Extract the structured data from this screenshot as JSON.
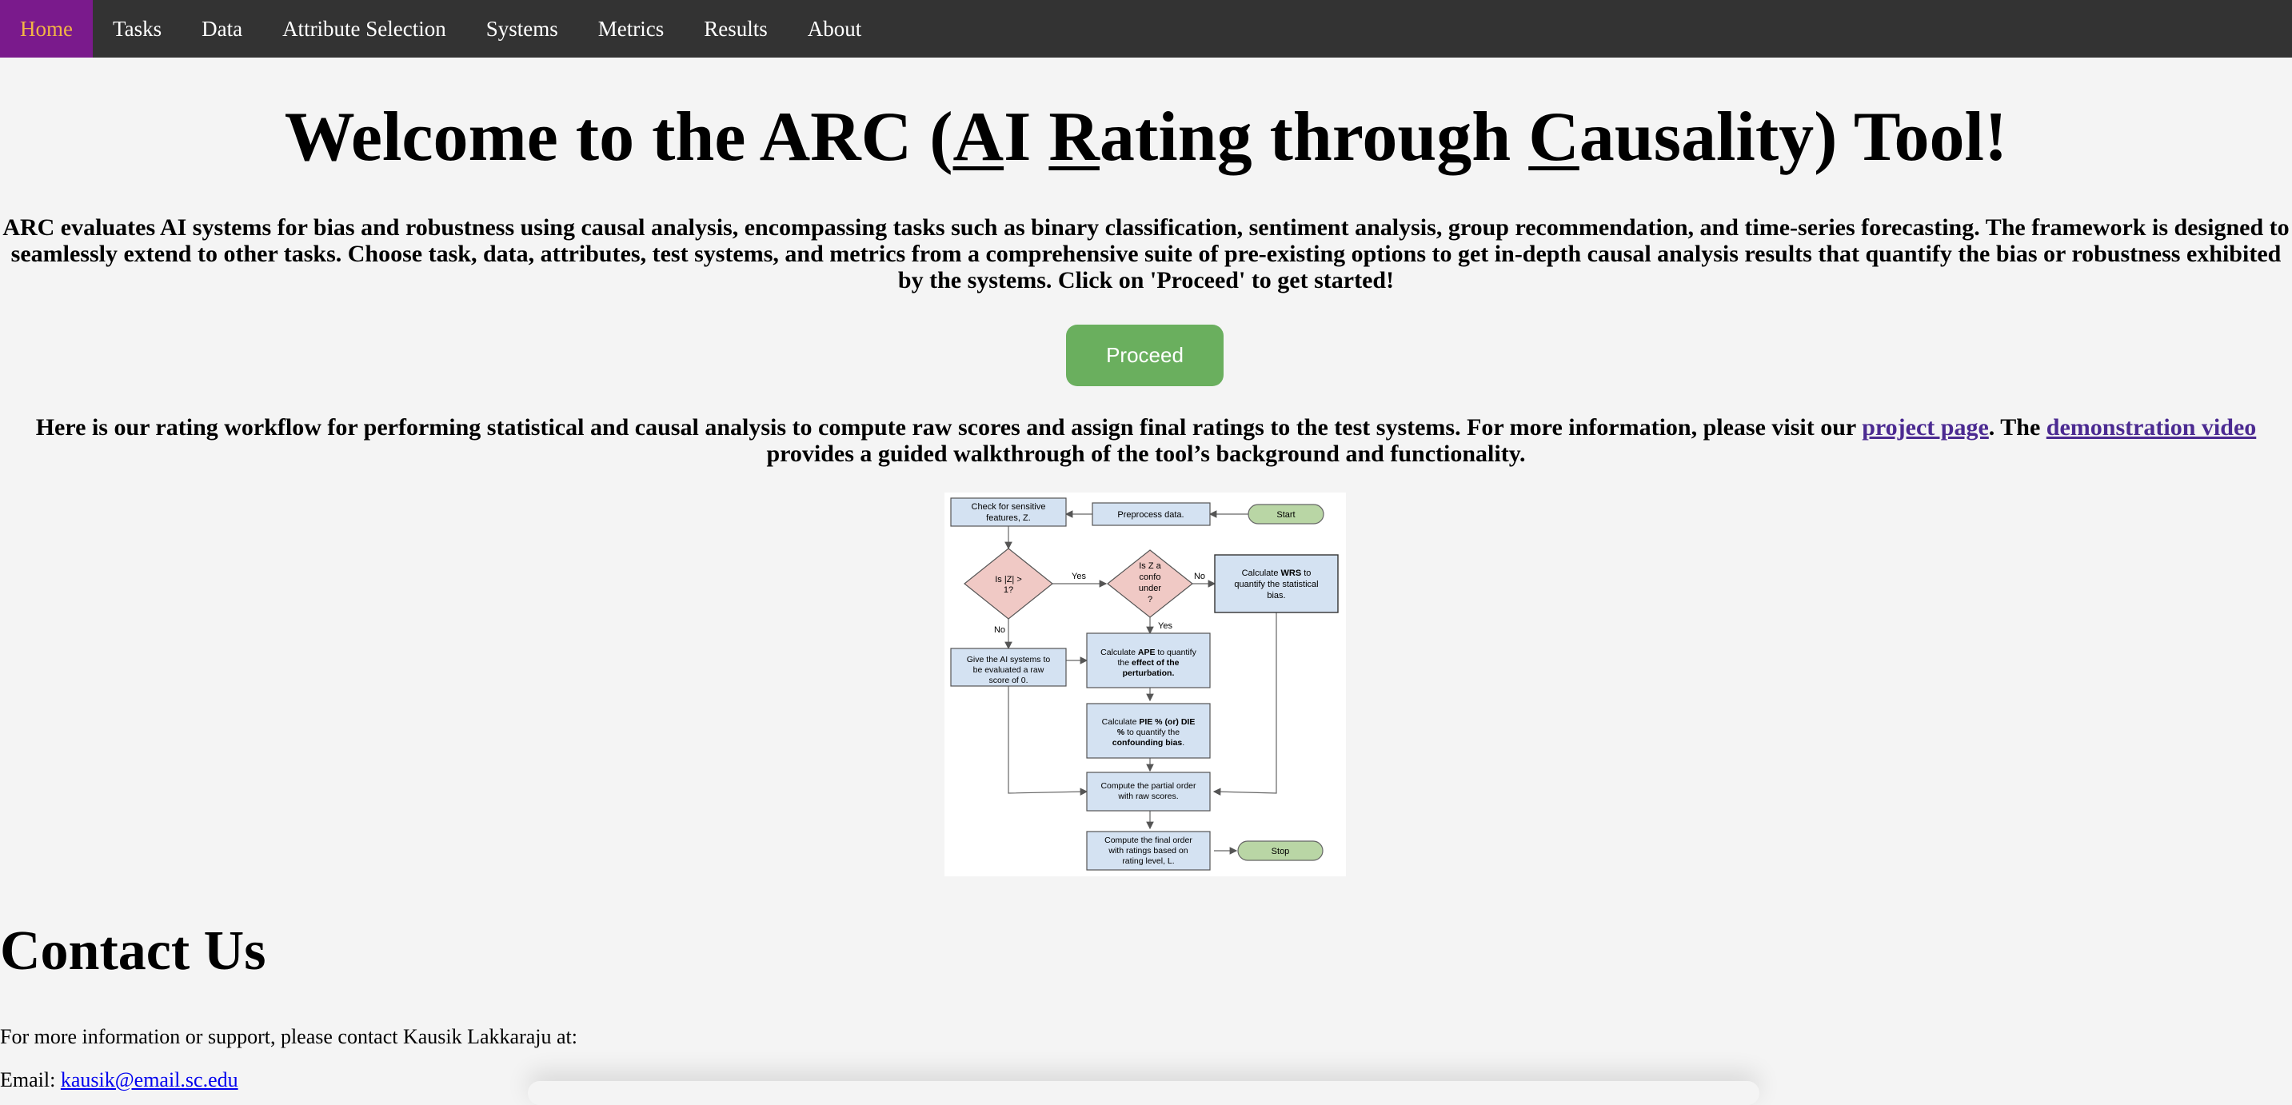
{
  "nav": {
    "items": [
      {
        "label": "Home"
      },
      {
        "label": "Tasks"
      },
      {
        "label": "Data"
      },
      {
        "label": "Attribute Selection"
      },
      {
        "label": "Systems"
      },
      {
        "label": "Metrics"
      },
      {
        "label": "Results"
      },
      {
        "label": "About"
      }
    ],
    "active_color": "#7a1a8c",
    "active_text_color": "#f2b544",
    "bar_color": "#333333"
  },
  "title": {
    "prefix": "Welcome to the ARC (",
    "a": "A",
    "i": "I ",
    "r": "R",
    "ating": "ating through ",
    "c": "C",
    "rest": "ausality) Tool!"
  },
  "intro": "ARC evaluates AI systems for bias and robustness using causal analysis, encompassing tasks such as binary classification, sentiment analysis, group recommendation, and time-series forecasting. The framework is designed to seamlessly extend to other tasks. Choose task, data, attributes, test systems, and metrics from a comprehensive suite of pre-existing options to get in-depth causal analysis results that quantify the bias or robustness exhibited by the systems. Click on 'Proceed' to get started!",
  "proceed_label": "Proceed",
  "proceed_color": "#6aaf5e",
  "workflow": {
    "text1": "Here is our rating workflow for performing statistical and causal analysis to compute raw scores and assign final ratings to the test systems. For more information, please visit our ",
    "link1": "project page",
    "text2": ". The ",
    "link2": "demonstration video",
    "text3": " provides a guided walkthrough of the tool’s background and functionality."
  },
  "diagram": {
    "start": "Start",
    "preprocess": "Preprocess data.",
    "check1": "Check for sensitive",
    "check2": "features, Z.",
    "isz1": "Is |Z| >",
    "isz2": "1?",
    "yes": "Yes",
    "no": "No",
    "conf1": "Is Z a",
    "conf2": "confo",
    "conf3": "under",
    "conf4": "?",
    "wrs1": "Calculate ",
    "wrs1b": "WRS",
    "wrs1c": " to",
    "wrs2": "quantify the statistical",
    "wrs3": "bias.",
    "give1": "Give the AI systems to",
    "give2": "be evaluated a raw",
    "give3": "score of 0.",
    "ape1": "Calculate ",
    "ape1b": "APE",
    "ape1c": " to quantify",
    "ape2": "the ",
    "ape2b": "effect of the",
    "ape3b": "perturbation.",
    "pie1": "Calculate ",
    "pie1b": "PIE % (or) DIE",
    "pie2b": "%",
    "pie2c": " to quantify the",
    "pie3b": "confounding bias",
    "pie3c": ".",
    "partial1": "Compute the partial order",
    "partial2": "with raw scores.",
    "final1": "Compute the final order",
    "final2": "with ratings based on",
    "final3": "rating level, L.",
    "stop": "Stop",
    "box_fill": "#d4e2f2",
    "diamond_fill": "#f0c9c5",
    "terminal_fill": "#b9d6a5"
  },
  "contact": {
    "heading": "Contact Us",
    "text": "For more information or support, please contact Kausik Lakkaraju at:",
    "email_label": "Email: ",
    "email": "kausik@email.sc.edu"
  }
}
